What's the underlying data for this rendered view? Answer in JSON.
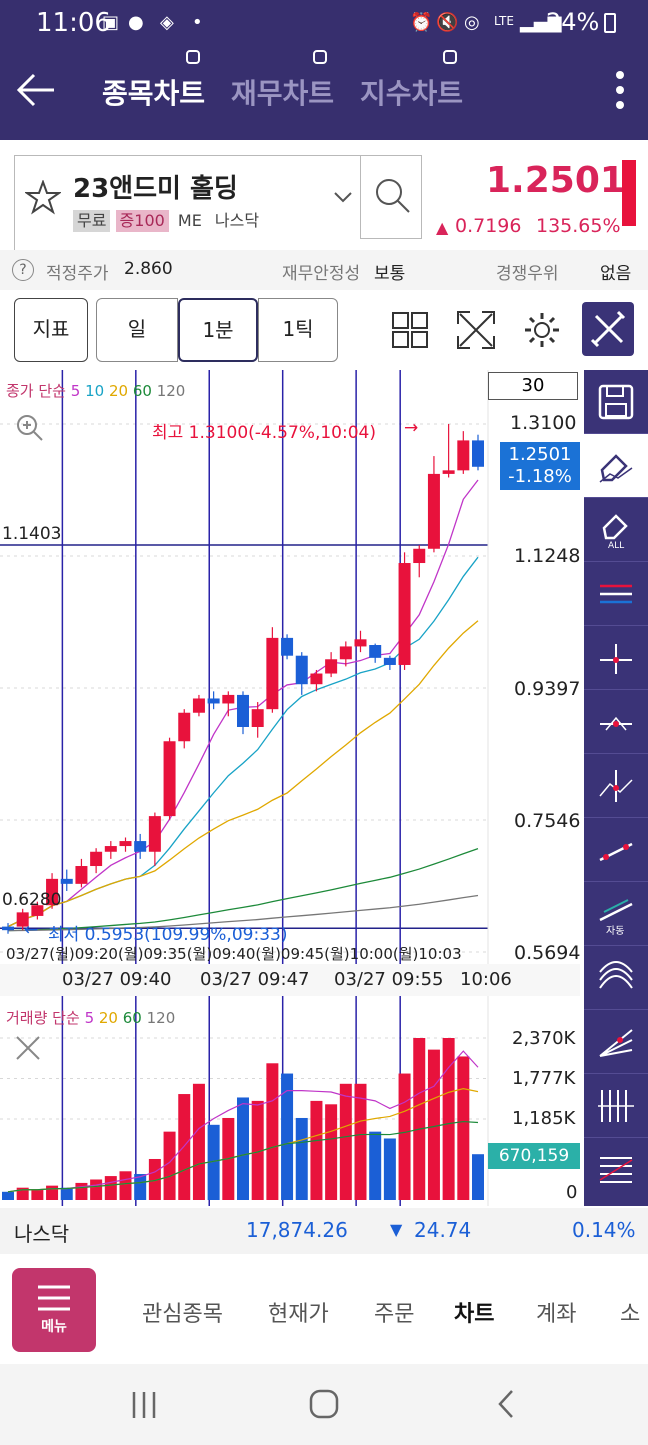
{
  "status": {
    "time": "11:06",
    "battery": "24%",
    "network": "LTE"
  },
  "header": {
    "tabs": [
      {
        "label": "종목차트",
        "active": true
      },
      {
        "label": "재무차트",
        "active": false
      },
      {
        "label": "지수차트",
        "active": false
      }
    ]
  },
  "stock": {
    "name": "23앤드미 홀딩",
    "tags": [
      "무료",
      "증100",
      "ME",
      "나스닥"
    ],
    "price": "1.2501",
    "change": "0.7196",
    "change_pct": "135.65%",
    "color_up": "#e8123c",
    "color_down": "#1b5fd6"
  },
  "info_row": {
    "fair_price_label": "적정주가",
    "fair_price": "2.860",
    "fin_label": "재무안정성",
    "fin_value": "보통",
    "comp_label": "경쟁우위",
    "comp_value": "없음"
  },
  "toolbar": {
    "indicator": "지표",
    "day": "일",
    "minute": "1분",
    "tick": "1틱"
  },
  "chart": {
    "ma_legend": {
      "prefix": "종가 단순",
      "p5": "5",
      "p10": "10",
      "p20": "20",
      "p60": "60",
      "p120": "120"
    },
    "period_box": "30",
    "high_label": "최고 1.3100(-4.57%,10:04)",
    "low_label": "최저 0.5953(109.99%,09:33)",
    "cur_price": "1.2501",
    "cur_pct": "-1.18%",
    "h_line_upper": "1.1403",
    "h_line_lower": "0.6280",
    "y_labels": [
      "1.3100",
      "1.1248",
      "0.9397",
      "0.7546",
      "0.5694"
    ],
    "x_labels": [
      "03/27 09:40",
      "03/27 09:47",
      "03/27 09:55",
      "10:06"
    ],
    "overlap_label": "03/27(월)09:20(월)09:35(월)09:40(월)09:45(월)10:00(월)10:03"
  },
  "volume": {
    "legend": {
      "prefix": "거래량 단순",
      "p5": "5",
      "p20": "20",
      "p60": "60",
      "p120": "120"
    },
    "y_labels": [
      "2,370K",
      "1,777K",
      "1,185K",
      "0"
    ],
    "current": "670,159"
  },
  "chart_data": {
    "type": "candlestick",
    "candles": [
      {
        "o": 0.6,
        "h": 0.61,
        "l": 0.595,
        "c": 0.605,
        "up": false
      },
      {
        "o": 0.605,
        "h": 0.63,
        "l": 0.6,
        "c": 0.625,
        "up": true
      },
      {
        "o": 0.62,
        "h": 0.64,
        "l": 0.615,
        "c": 0.635,
        "up": true
      },
      {
        "o": 0.635,
        "h": 0.68,
        "l": 0.63,
        "c": 0.672,
        "up": true
      },
      {
        "o": 0.672,
        "h": 0.685,
        "l": 0.655,
        "c": 0.665,
        "up": false
      },
      {
        "o": 0.665,
        "h": 0.7,
        "l": 0.66,
        "c": 0.69,
        "up": true
      },
      {
        "o": 0.69,
        "h": 0.715,
        "l": 0.68,
        "c": 0.71,
        "up": true
      },
      {
        "o": 0.71,
        "h": 0.725,
        "l": 0.7,
        "c": 0.718,
        "up": true
      },
      {
        "o": 0.718,
        "h": 0.73,
        "l": 0.71,
        "c": 0.725,
        "up": true
      },
      {
        "o": 0.725,
        "h": 0.735,
        "l": 0.7,
        "c": 0.71,
        "up": false
      },
      {
        "o": 0.71,
        "h": 0.765,
        "l": 0.69,
        "c": 0.76,
        "up": true
      },
      {
        "o": 0.76,
        "h": 0.87,
        "l": 0.755,
        "c": 0.865,
        "up": true
      },
      {
        "o": 0.865,
        "h": 0.91,
        "l": 0.855,
        "c": 0.905,
        "up": true
      },
      {
        "o": 0.905,
        "h": 0.93,
        "l": 0.9,
        "c": 0.925,
        "up": true
      },
      {
        "o": 0.925,
        "h": 0.935,
        "l": 0.91,
        "c": 0.918,
        "up": false
      },
      {
        "o": 0.918,
        "h": 0.935,
        "l": 0.9,
        "c": 0.93,
        "up": true
      },
      {
        "o": 0.93,
        "h": 0.935,
        "l": 0.875,
        "c": 0.885,
        "up": false
      },
      {
        "o": 0.885,
        "h": 0.92,
        "l": 0.87,
        "c": 0.91,
        "up": true
      },
      {
        "o": 0.91,
        "h": 1.025,
        "l": 0.905,
        "c": 1.01,
        "up": true
      },
      {
        "o": 1.01,
        "h": 1.015,
        "l": 0.98,
        "c": 0.985,
        "up": false
      },
      {
        "o": 0.985,
        "h": 0.99,
        "l": 0.93,
        "c": 0.945,
        "up": false
      },
      {
        "o": 0.945,
        "h": 0.965,
        "l": 0.935,
        "c": 0.96,
        "up": true
      },
      {
        "o": 0.96,
        "h": 0.99,
        "l": 0.955,
        "c": 0.98,
        "up": true
      },
      {
        "o": 0.98,
        "h": 1.005,
        "l": 0.97,
        "c": 0.998,
        "up": true
      },
      {
        "o": 0.998,
        "h": 1.02,
        "l": 0.99,
        "c": 1.008,
        "up": true
      },
      {
        "o": 1.0,
        "h": 1.002,
        "l": 0.975,
        "c": 0.982,
        "up": false
      },
      {
        "o": 0.982,
        "h": 0.985,
        "l": 0.965,
        "c": 0.972,
        "up": false
      },
      {
        "o": 0.972,
        "h": 1.13,
        "l": 0.965,
        "c": 1.115,
        "up": true
      },
      {
        "o": 1.115,
        "h": 1.14,
        "l": 1.095,
        "c": 1.135,
        "up": true
      },
      {
        "o": 1.135,
        "h": 1.265,
        "l": 1.13,
        "c": 1.24,
        "up": true
      },
      {
        "o": 1.24,
        "h": 1.31,
        "l": 1.235,
        "c": 1.245,
        "up": true
      },
      {
        "o": 1.245,
        "h": 1.3,
        "l": 1.24,
        "c": 1.287,
        "up": true
      },
      {
        "o": 1.287,
        "h": 1.295,
        "l": 1.245,
        "c": 1.25,
        "up": false
      }
    ],
    "volumes": [
      120,
      180,
      150,
      210,
      180,
      250,
      300,
      350,
      420,
      380,
      600,
      1000,
      1550,
      1700,
      1100,
      1200,
      1500,
      1450,
      2000,
      1850,
      1200,
      1450,
      1400,
      1700,
      1700,
      1000,
      900,
      1850,
      2370,
      2200,
      2370,
      2100,
      670
    ],
    "price_range": [
      0.5694,
      1.31
    ],
    "volume_range": [
      0,
      2370
    ]
  }
}
